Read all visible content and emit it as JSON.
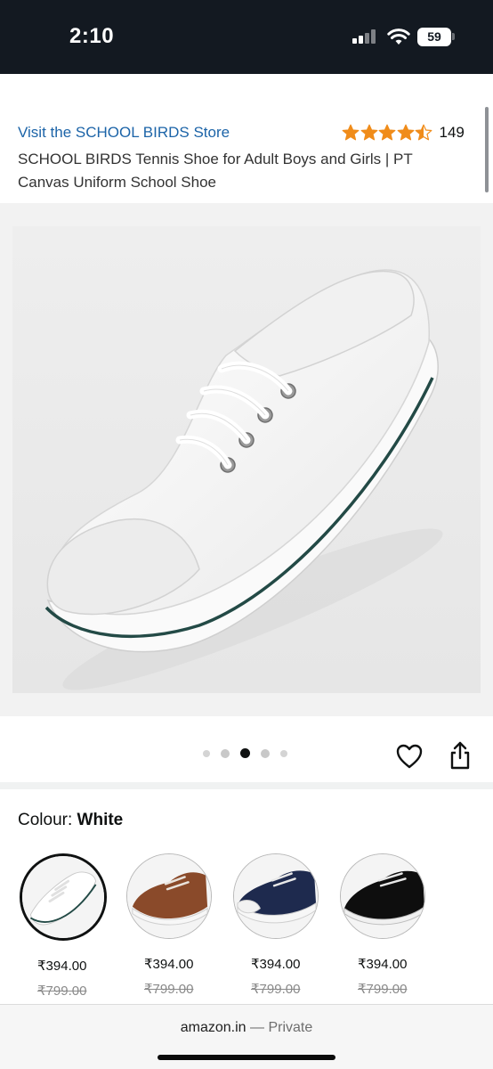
{
  "status_bar": {
    "time": "2:10",
    "battery": "59"
  },
  "product": {
    "store_link": "Visit the SCHOOL BIRDS Store",
    "rating_value": 4.5,
    "rating_out_of": 5,
    "rating_count": "149",
    "title": "SCHOOL BIRDS Tennis Shoe for Adult Boys and Girls | PT Canvas Uniform School Shoe"
  },
  "gallery": {
    "image_count": 5,
    "active_index": 2
  },
  "colour": {
    "label": "Colour:",
    "selected": "White"
  },
  "swatches": [
    {
      "price": "₹394.00",
      "mrp": "₹799.00",
      "shoe_color": "#f4f4f4",
      "selected": true
    },
    {
      "price": "₹394.00",
      "mrp": "₹799.00",
      "shoe_color": "#8a4a2a",
      "selected": false
    },
    {
      "price": "₹394.00",
      "mrp": "₹799.00",
      "shoe_color": "#1e2a4e",
      "selected": false
    },
    {
      "price": "₹394.00",
      "mrp": "₹799.00",
      "shoe_color": "#0e0e0e",
      "selected": false
    }
  ],
  "browser": {
    "domain": "amazon.in",
    "mode": " — Private"
  },
  "colors": {
    "status_bar_bg": "#131921",
    "link": "#1c64a8",
    "star": "#f08c1a"
  },
  "icons": {
    "heart": "heart-icon",
    "share": "share-icon"
  }
}
